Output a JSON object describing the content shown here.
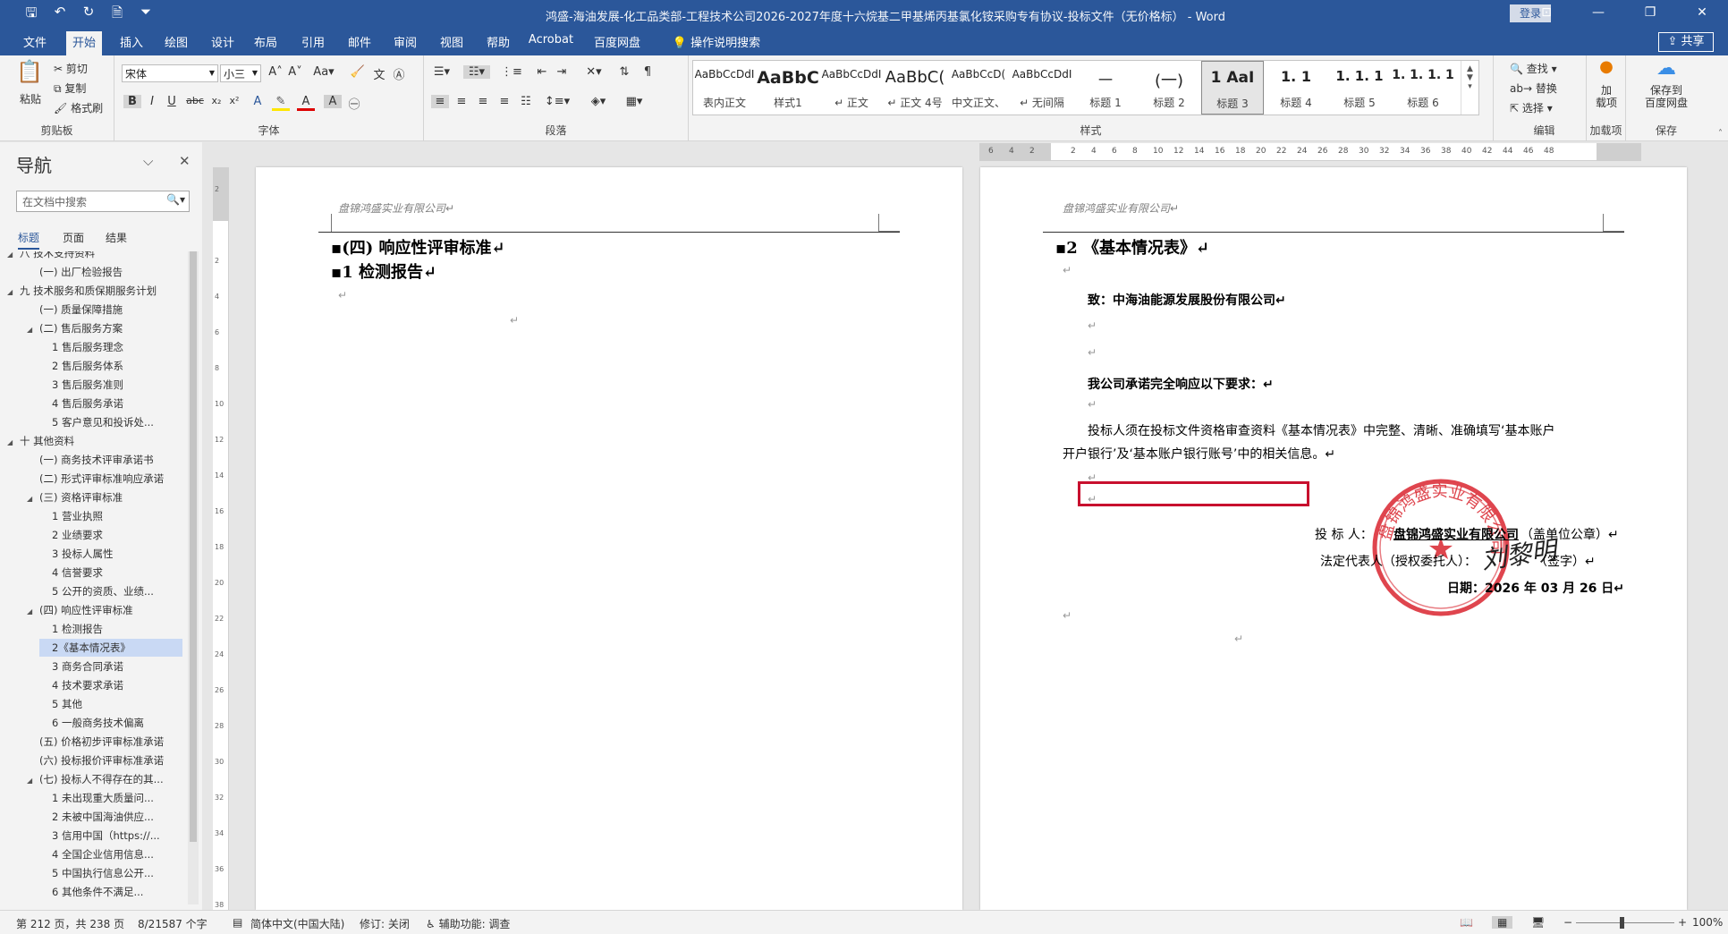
{
  "app": {
    "title": "鸿盛-海油发展-化工品类部-工程技术公司2026-2027年度十六烷基二甲基烯丙基氯化铵采购专有协议-投标文件（无价格标） - Word",
    "login": "登录",
    "share": "共享"
  },
  "qat": {
    "save": "save-icon",
    "undo": "undo-icon",
    "redo": "redo-icon",
    "customize": "customize-icon"
  },
  "tabs": [
    "文件",
    "开始",
    "插入",
    "绘图",
    "设计",
    "布局",
    "引用",
    "邮件",
    "审阅",
    "视图",
    "帮助",
    "Acrobat",
    "百度网盘"
  ],
  "tell_me": "操作说明搜索",
  "ribbon": {
    "clipboard": {
      "label": "剪贴板",
      "paste": "粘贴",
      "cut": "剪切",
      "copy": "复制",
      "format_painter": "格式刷"
    },
    "font": {
      "label": "字体",
      "family": "宋体",
      "size": "小三"
    },
    "paragraph": {
      "label": "段落"
    },
    "styles": {
      "label": "样式",
      "items": [
        {
          "sample": "AaBbCcDdI",
          "name": "表内正文"
        },
        {
          "sample": "AaBbC",
          "name": "样式1"
        },
        {
          "sample": "AaBbCcDdI",
          "name": "↵ 正文"
        },
        {
          "sample": "AaBbC(",
          "name": "↵ 正文 4号"
        },
        {
          "sample": "AaBbCcD(",
          "name": "中文正文、"
        },
        {
          "sample": "AaBbCcDdI",
          "name": "↵ 无间隔"
        },
        {
          "sample": "一",
          "name": "标题 1"
        },
        {
          "sample": "(一)",
          "name": "标题 2"
        },
        {
          "sample": "1  AaI",
          "name": "标题 3"
        },
        {
          "sample": "1. 1",
          "name": "标题 4"
        },
        {
          "sample": "1. 1. 1",
          "name": "标题 5"
        },
        {
          "sample": "1. 1. 1. 1",
          "name": "标题 6"
        }
      ]
    },
    "editing": {
      "label": "编辑",
      "find": "查找",
      "replace": "替换",
      "select": "选择"
    },
    "addins": {
      "label": "加载项",
      "btn": "加\n载项"
    },
    "save_group": {
      "label": "保存",
      "btn": "保存到\n百度网盘"
    }
  },
  "nav": {
    "title": "导航",
    "search_placeholder": "在文档中搜索",
    "tabs": [
      "标题",
      "页面",
      "结果"
    ],
    "items": [
      {
        "text": "八 技术支持资料",
        "level": 1,
        "tri": "◢"
      },
      {
        "text": "(一) 出厂检验报告",
        "level": 2,
        "tri": ""
      },
      {
        "text": "九 技术服务和质保期服务计划",
        "level": 1,
        "tri": "◢"
      },
      {
        "text": "(一) 质量保障措施",
        "level": 2,
        "tri": ""
      },
      {
        "text": "(二) 售后服务方案",
        "level": 2,
        "tri": "◢"
      },
      {
        "text": "1 售后服务理念",
        "level": 3,
        "tri": ""
      },
      {
        "text": "2 售后服务体系",
        "level": 3,
        "tri": ""
      },
      {
        "text": "3 售后服务准则",
        "level": 3,
        "tri": ""
      },
      {
        "text": "4 售后服务承诺",
        "level": 3,
        "tri": ""
      },
      {
        "text": "5 客户意见和投诉处...",
        "level": 3,
        "tri": ""
      },
      {
        "text": "十 其他资料",
        "level": 1,
        "tri": "◢"
      },
      {
        "text": "(一) 商务技术评审承诺书",
        "level": 2,
        "tri": ""
      },
      {
        "text": "(二) 形式评审标准响应承诺",
        "level": 2,
        "tri": ""
      },
      {
        "text": "(三) 资格评审标准",
        "level": 2,
        "tri": "◢"
      },
      {
        "text": "1 营业执照",
        "level": 3,
        "tri": ""
      },
      {
        "text": "2 业绩要求",
        "level": 3,
        "tri": ""
      },
      {
        "text": "3 投标人属性",
        "level": 3,
        "tri": ""
      },
      {
        "text": "4 信誉要求",
        "level": 3,
        "tri": ""
      },
      {
        "text": "5 公开的资质、业绩...",
        "level": 3,
        "tri": ""
      },
      {
        "text": "(四) 响应性评审标准",
        "level": 2,
        "tri": "◢"
      },
      {
        "text": "1 检测报告",
        "level": 3,
        "tri": ""
      },
      {
        "text": "2《基本情况表》",
        "level": 3,
        "tri": "",
        "selected": true
      },
      {
        "text": "3 商务合同承诺",
        "level": 3,
        "tri": ""
      },
      {
        "text": "4 技术要求承诺",
        "level": 3,
        "tri": ""
      },
      {
        "text": "5 其他",
        "level": 3,
        "tri": ""
      },
      {
        "text": "6 一般商务技术偏离",
        "level": 3,
        "tri": ""
      },
      {
        "text": "(五) 价格初步评审标准承诺",
        "level": 2,
        "tri": ""
      },
      {
        "text": "(六) 投标报价评审标准承诺",
        "level": 2,
        "tri": ""
      },
      {
        "text": "(七) 投标人不得存在的其...",
        "level": 2,
        "tri": "◢"
      },
      {
        "text": "1 未出现重大质量问...",
        "level": 3,
        "tri": ""
      },
      {
        "text": "2 未被中国海油供应...",
        "level": 3,
        "tri": ""
      },
      {
        "text": "3 信用中国（https://...",
        "level": 3,
        "tri": ""
      },
      {
        "text": "4 全国企业信用信息...",
        "level": 3,
        "tri": ""
      },
      {
        "text": "5 中国执行信息公开...",
        "level": 3,
        "tri": ""
      },
      {
        "text": "6 其他条件不满足...",
        "level": 3,
        "tri": ""
      }
    ]
  },
  "ruler": {
    "h": [
      "6",
      "4",
      "2",
      "",
      "2",
      "4",
      "6",
      "8",
      "10",
      "12",
      "14",
      "16",
      "18",
      "20",
      "22",
      "24",
      "26",
      "28",
      "30",
      "32",
      "34",
      "36",
      "38",
      "40",
      "42",
      "44",
      "46",
      "48"
    ],
    "v": [
      "2",
      "",
      "2",
      "4",
      "6",
      "8",
      "10",
      "12",
      "14",
      "16",
      "18",
      "20",
      "22",
      "24",
      "26",
      "28",
      "30",
      "32",
      "34",
      "36",
      "38"
    ]
  },
  "page_left": {
    "header": "盘锦鸿盛实业有限公司↵",
    "h1": "▪(四)  响应性评审标准↵",
    "h2": "▪1   检测报告↵",
    "p1": "↵",
    "p2": "↵"
  },
  "page_right": {
    "header": "盘锦鸿盛实业有限公司↵",
    "h1": "▪2   《基本情况表》↵",
    "empty": "↵",
    "to": "致：中海油能源发展股份有限公司↵",
    "commit": "我公司承诺完全响应以下要求：↵",
    "body1": "投标人须在投标文件资格审查资料《基本情况表》中完整、清晰、准确填写‘基本账户",
    "body2": "开户银行’及‘基本账户银行账号’中的相关信息。↵",
    "bidder_label": "投    标    人：",
    "bidder_name": "盘锦鸿盛实业有限公司",
    "bidder_note": "（盖单位公章）↵",
    "rep_label": "法定代表人（授权委托人）：",
    "rep_note": "（签字）↵",
    "date": "日期：2026 年 03 月 26 日↵",
    "seal_text": "盘锦鸿盛实业有限公司",
    "signature": "刘黎明"
  },
  "status": {
    "page": "第 212 页，共 238 页",
    "words": "8/21587 个字",
    "lang": "简体中文(中国大陆)",
    "track": "修订: 关闭",
    "access": "辅助功能: 调查",
    "zoom": "100%",
    "zoom_minus": "−",
    "zoom_plus": "+"
  },
  "colors": {
    "accent": "#2b579a",
    "seal": "#d9252f",
    "highlight": "#c8102e"
  }
}
